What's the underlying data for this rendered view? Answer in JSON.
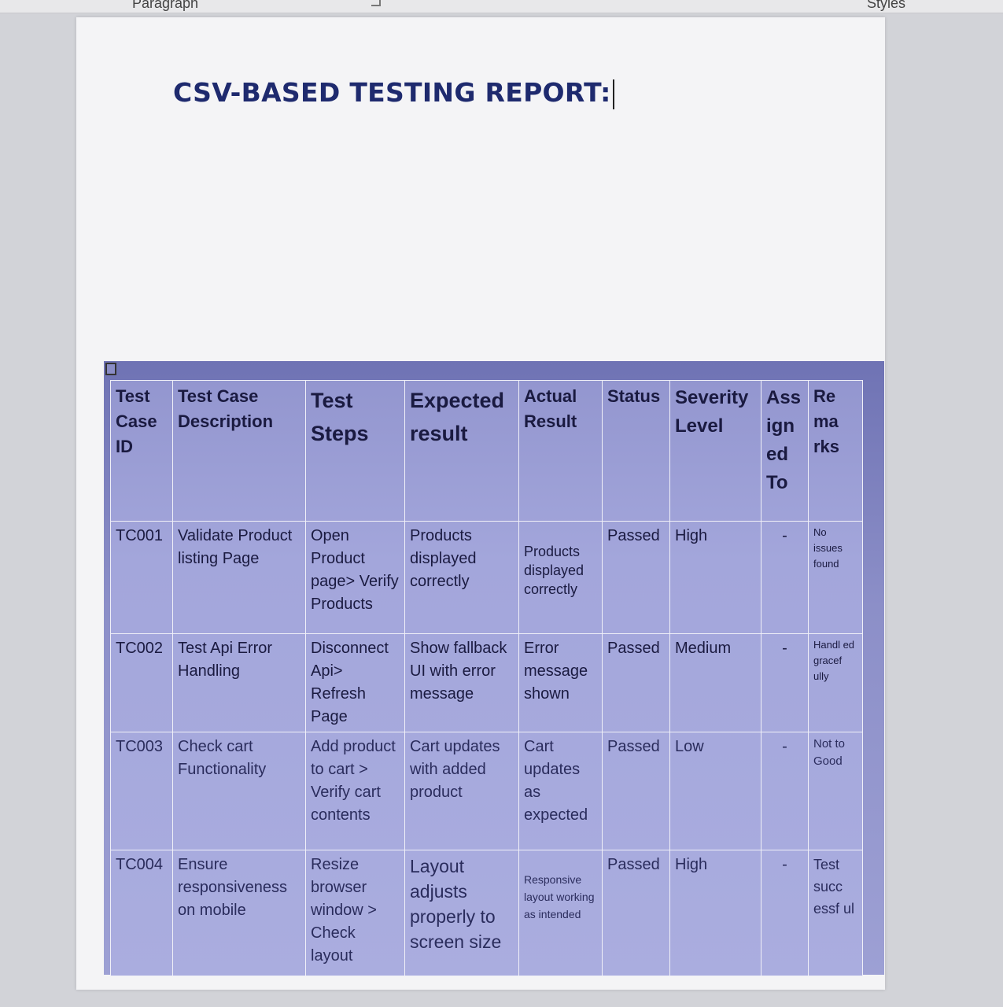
{
  "ribbon": {
    "paragraph_label": "Paragraph",
    "styles_label": "Styles"
  },
  "document": {
    "title": "CSV-BASED TESTING REPORT:"
  },
  "table": {
    "headers": [
      "Test Case ID",
      "Test Case Description",
      "Test Steps",
      "Expected result",
      "Actual Result",
      "Status",
      "Severity Level",
      "Ass ign ed To",
      "Re ma rks"
    ],
    "rows": [
      {
        "id": "TC001",
        "description": "Validate Product listing Page",
        "steps": "Open Product page> Verify Products",
        "expected": "Products displayed correctly",
        "actual": "Products displayed correctly",
        "status": "Passed",
        "severity": "High",
        "assigned": "-",
        "remarks": "No issues found"
      },
      {
        "id": "TC002",
        "description": "Test Api Error Handling",
        "steps": "Disconnect Api> Refresh Page",
        "expected": "Show fallback UI with error message",
        "actual": "Error message shown",
        "status": "Passed",
        "severity": "Medium",
        "assigned": "-",
        "remarks": "Handl ed gracef ully"
      },
      {
        "id": "TC003",
        "description": "Check cart Functionality",
        "steps": "Add product to cart > Verify cart contents",
        "expected": "Cart updates with added product",
        "actual": "Cart updates as expected",
        "status": "Passed",
        "severity": "Low",
        "assigned": "-",
        "remarks": "Not to Good"
      },
      {
        "id": "TC004",
        "description": "Ensure responsiveness on mobile",
        "steps": "Resize browser window > Check layout",
        "expected": "Layout adjusts properly to screen size",
        "actual": "Responsive layout working as intended",
        "status": "Passed",
        "severity": "High",
        "assigned": "-",
        "remarks": "Test succ essf ul"
      }
    ]
  }
}
